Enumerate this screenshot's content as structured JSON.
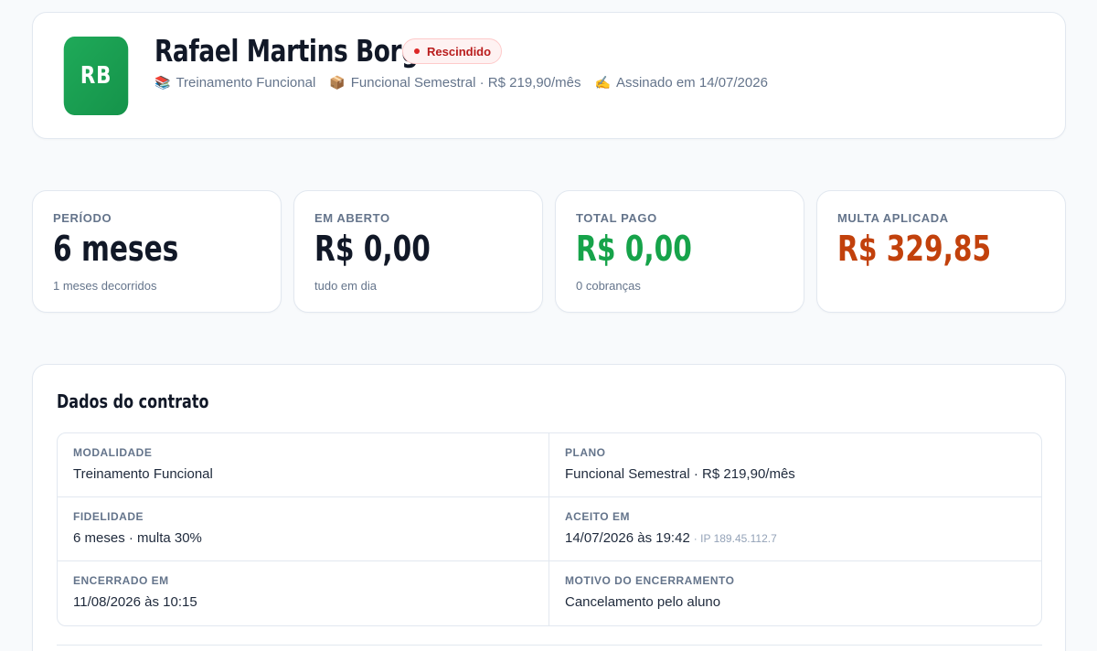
{
  "header": {
    "initials": "RB",
    "name": "Rafael Martins Borges",
    "status": "Rescindido",
    "modality_icon": "📚",
    "modality": "Treinamento Funcional",
    "plan_icon": "📦",
    "plan": "Funcional Semestral · R$ 219,90/mês",
    "signed_icon": "✍️",
    "signed": "Assinado em 14/07/2026"
  },
  "stats": [
    {
      "label": "PERÍODO",
      "value": "6 meses",
      "sub": "1 meses decorridos",
      "color": "#111827"
    },
    {
      "label": "EM ABERTO",
      "value": "R$ 0,00",
      "sub": "tudo em dia",
      "color": "#111827"
    },
    {
      "label": "TOTAL PAGO",
      "value": "R$ 0,00",
      "sub": "0 cobranças",
      "color": "#16a34a"
    },
    {
      "label": "MULTA APLICADA",
      "value": "R$ 329,85",
      "sub": "",
      "color": "#c2410c"
    }
  ],
  "contract": {
    "title": "Dados do contrato",
    "fields": [
      {
        "label": "MODALIDADE",
        "value": "Treinamento Funcional"
      },
      {
        "label": "PLANO",
        "value": "Funcional Semestral · R$ 219,90/mês"
      },
      {
        "label": "FIDELIDADE",
        "value": "6 meses · multa 30%"
      },
      {
        "label": "ACEITO EM",
        "value": "14/07/2026 às 19:42",
        "note": "· IP 189.45.112.7"
      },
      {
        "label": "ENCERRADO EM",
        "value": "11/08/2026 às 10:15"
      },
      {
        "label": "MOTIVO DO ENCERRAMENTO",
        "value": "Cancelamento pelo aluno"
      }
    ]
  },
  "colors": {
    "avatar": "#1faa59",
    "status_text": "#b91c1c",
    "paid": "#16a34a",
    "penalty": "#c2410c"
  }
}
